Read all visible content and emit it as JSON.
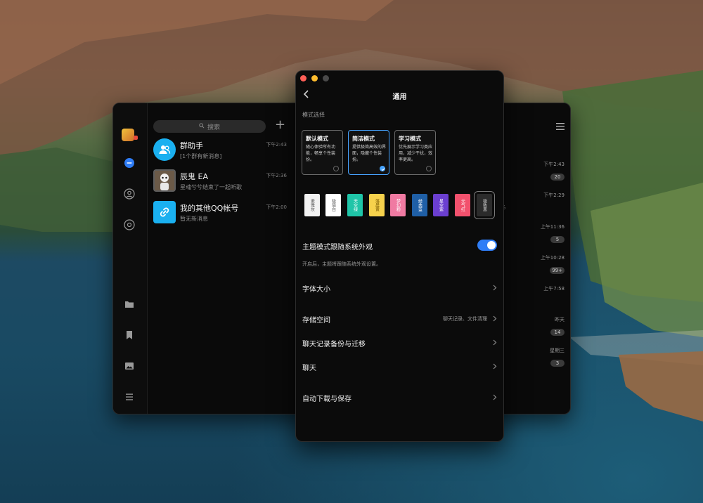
{
  "chat_window": {
    "search_placeholder": "搜索",
    "chats": [
      {
        "name": "群助手",
        "preview": "[1个群有新消息]",
        "time": "下午2:43",
        "avatar_color": "#1ab0f0",
        "icon": "group-icon"
      },
      {
        "name": "辰鬼 EA",
        "preview": "星魂兮兮结束了一起听歌",
        "time": "下午2:36",
        "avatar_color": "#5d5d5d",
        "icon": "robot-avatar"
      },
      {
        "name": "我的其他QQ帐号",
        "preview": "暂无新消息",
        "time": "下午2:00",
        "avatar_color": "#1ab0f0",
        "icon": "link-icon"
      }
    ],
    "right_column": [
      {
        "time": "下午2:43",
        "badge": "20"
      },
      {
        "time": "下午2:29",
        "badge": ""
      },
      {
        "time": "上午11:36",
        "badge": "5"
      },
      {
        "time": "上午10:28",
        "badge": "99+"
      },
      {
        "time": "上午7:58",
        "badge": ""
      },
      {
        "time": "昨天",
        "badge": "14"
      },
      {
        "time": "星期三",
        "badge": "3"
      }
    ],
    "side_peek_text": "多"
  },
  "settings": {
    "title": "通用",
    "section_mode": "模式选择",
    "modes": [
      {
        "name": "默认模式",
        "desc": "随心体验所有功能，畅享个性装扮。",
        "selected": false
      },
      {
        "name": "简洁模式",
        "desc": "提供极简高效的界面，隐藏个性装扮。",
        "selected": true
      },
      {
        "name": "学习模式",
        "desc": "优先展示学习类应用，减少干扰，效率更高。",
        "selected": false
      }
    ],
    "themes": [
      {
        "name": "素雅灰",
        "bg": "#f2f2f2",
        "fg": "#555555"
      },
      {
        "name": "极简白",
        "bg": "#ffffff",
        "fg": "#555555"
      },
      {
        "name": "天空绿",
        "bg": "#1fc5a8",
        "fg": "#ffffff"
      },
      {
        "name": "落晨黄",
        "bg": "#f7d24c",
        "fg": "#7a5a00"
      },
      {
        "name": "梦幻粉",
        "bg": "#f07aa2",
        "fg": "#ffffff"
      },
      {
        "name": "经典蓝",
        "bg": "#1f5fa6",
        "fg": "#ffffff"
      },
      {
        "name": "星空紫",
        "bg": "#6b3fd0",
        "fg": "#ffffff"
      },
      {
        "name": "元气红",
        "bg": "#f2516d",
        "fg": "#ffffff"
      },
      {
        "name": "极致黑",
        "bg": "#2b2b2b",
        "fg": "#dddddd"
      }
    ],
    "follow_system": {
      "label": "主题模式跟随系统外观",
      "hint": "开启后，主题将跟随系统外观设置。",
      "enabled": true
    },
    "font_size_label": "字体大小",
    "storage": {
      "label": "存储空间",
      "value": "聊天记录、文件清理"
    },
    "backup_label": "聊天记录备份与迁移",
    "chat_label": "聊天",
    "auto_download_label": "自动下载与保存"
  }
}
